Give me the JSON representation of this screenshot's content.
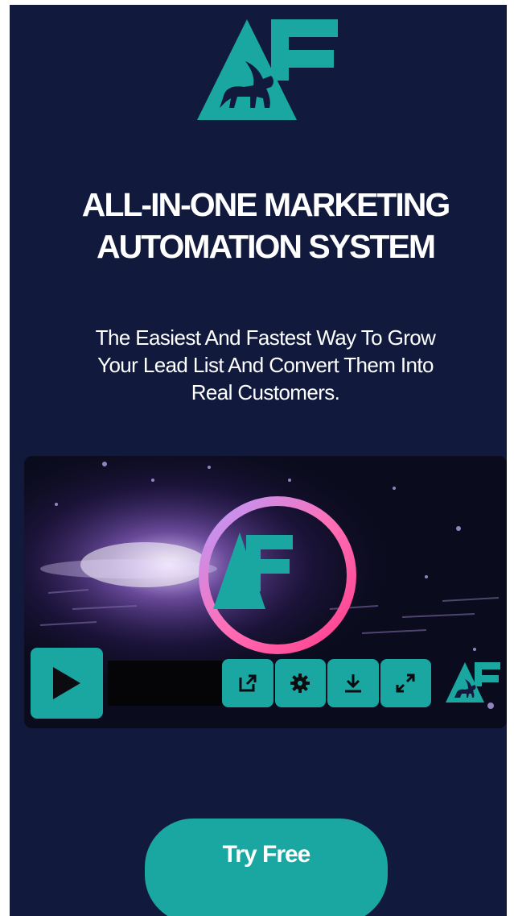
{
  "brand": {
    "logo_icon": "af-griffin-logo-icon",
    "accent": "#1aa6a1",
    "background": "#111a3c"
  },
  "hero": {
    "headline_line1": "ALL-IN-ONE MARKETING",
    "headline_line2": "AUTOMATION SYSTEM",
    "subhead_line1": "The Easiest And Fastest Way To Grow",
    "subhead_line2": "Your Lead List And Convert Them Into",
    "subhead_line3": "Real Customers."
  },
  "video": {
    "progress": 0,
    "controls": {
      "play_icon": "play-icon",
      "share_icon": "external-link-icon",
      "settings_icon": "gear-icon",
      "download_icon": "download-icon",
      "fullscreen_icon": "expand-icon",
      "brand_icon": "af-griffin-logo-icon"
    }
  },
  "cta": {
    "label": "Try Free"
  }
}
